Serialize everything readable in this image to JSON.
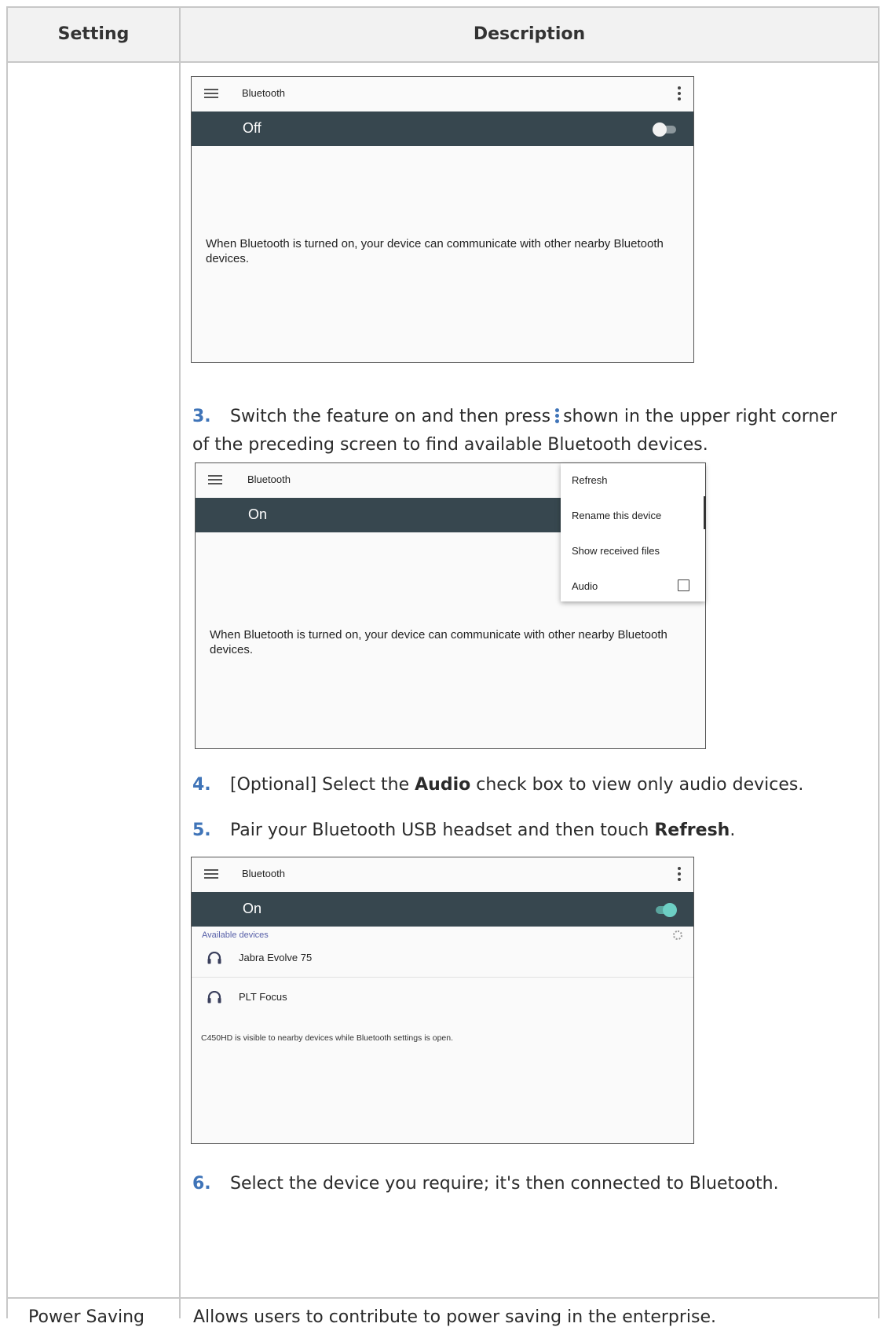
{
  "table": {
    "header_setting": "Setting",
    "header_description": "Description"
  },
  "screen1": {
    "title": "Bluetooth",
    "state": "Off",
    "info": "When Bluetooth is turned on, your device can communicate with other nearby Bluetooth devices."
  },
  "step3": {
    "num": "3.",
    "text_before": "Switch the feature on and then press",
    "text_after": "shown in the upper right corner of the preceding screen to find available Bluetooth devices."
  },
  "screen2": {
    "title": "Bluetooth",
    "state": "On",
    "info": "When Bluetooth is turned on, your device can communicate with other nearby Bluetooth devices.",
    "menu": {
      "refresh": "Refresh",
      "rename": "Rename this device",
      "show_files": "Show received files",
      "audio": "Audio"
    }
  },
  "step4": {
    "num": "4.",
    "pre": "[Optional] Select the",
    "bold": "Audio",
    "post": "check box to view only audio devices."
  },
  "step5": {
    "num": "5.",
    "pre": "Pair your Bluetooth USB headset and then touch",
    "bold": "Refresh",
    "post": "."
  },
  "screen3": {
    "title": "Bluetooth",
    "state": "On",
    "available_header": "Available devices",
    "devices": [
      "Jabra Evolve 75",
      "PLT Focus"
    ],
    "visible_note": "C450HD is visible to nearby devices while Bluetooth settings is open."
  },
  "step6": {
    "num": "6.",
    "text": "Select the device you require; it's then connected to Bluetooth."
  },
  "power_saving": {
    "setting": "Power Saving",
    "description": "Allows users to contribute to power saving in the enterprise."
  }
}
